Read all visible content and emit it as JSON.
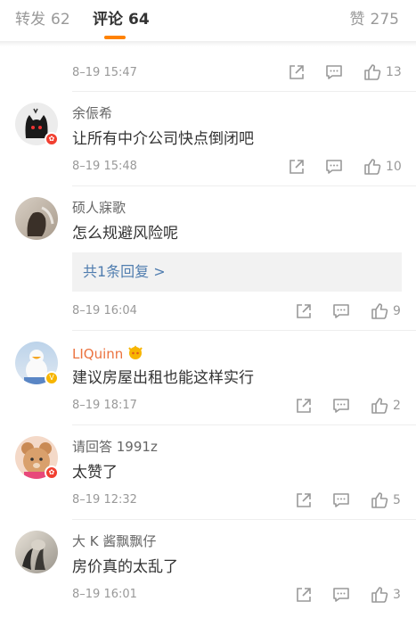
{
  "tabs": {
    "repost": {
      "label": "转发",
      "count": "62"
    },
    "comments": {
      "label": "评论",
      "count": "64"
    },
    "likes": {
      "label": "赞",
      "count": "275"
    }
  },
  "first": {
    "time": "8–19 15:47",
    "likes": "13"
  },
  "comments": [
    {
      "user": "余侲希",
      "text": "让所有中介公司快点倒闭吧",
      "time": "8–19 15:48",
      "likes": "10",
      "badge": "red"
    },
    {
      "user": "硕人寐歌",
      "text": "怎么规避风险呢",
      "reply_link": "共1条回复 >",
      "time": "8–19 16:04",
      "likes": "9"
    },
    {
      "user": "LIQuinn",
      "text": "建议房屋出租也能这样实行",
      "time": "8–19 18:17",
      "likes": "2",
      "badge": "gold"
    },
    {
      "user": "请回答 1991z",
      "text": "太赞了",
      "time": "8–19 12:32",
      "likes": "5",
      "badge": "red"
    },
    {
      "user": "大 K 酱飘飘仔",
      "text": "房价真的太乱了",
      "time": "8–19 16:01",
      "likes": "3"
    }
  ],
  "colors": {
    "accent": "#ff8200",
    "link": "#507daf",
    "vip_name": "#eb7340"
  }
}
